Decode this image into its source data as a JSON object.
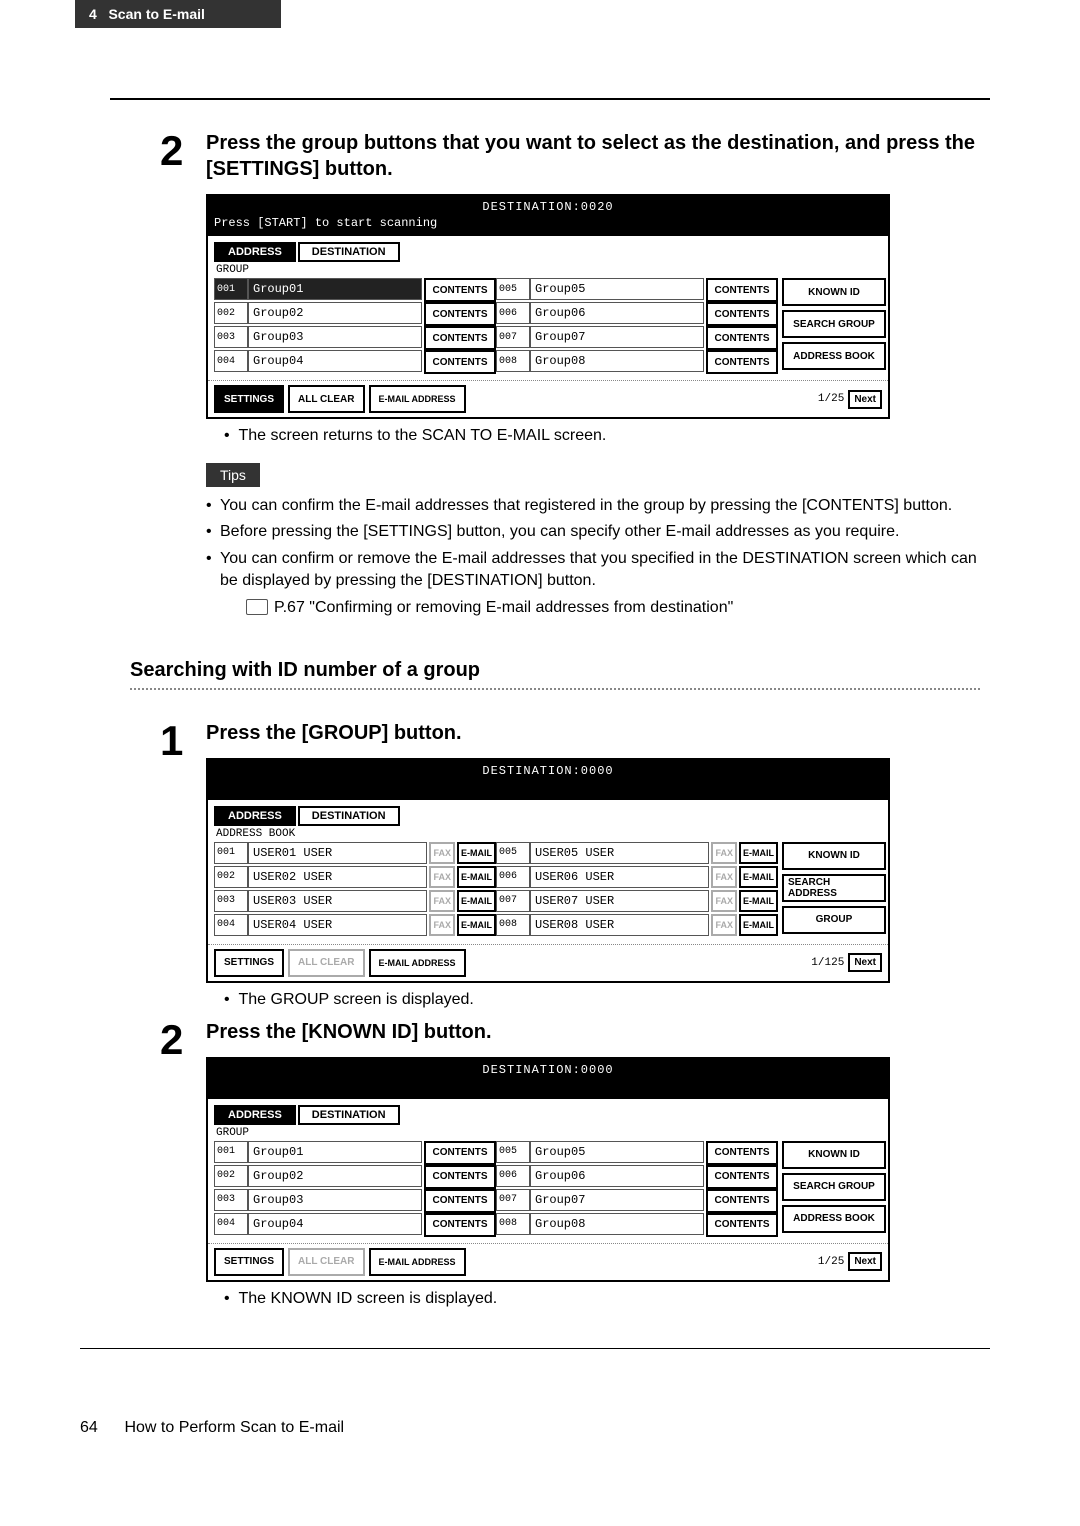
{
  "header": {
    "chapter": "4",
    "title": "Scan to E-mail"
  },
  "step2a": {
    "num": "2",
    "title": "Press the group buttons that you want to select as the destination, and press the [SETTINGS] button.",
    "note": "The screen returns to the SCAN TO E-MAIL screen."
  },
  "panel1": {
    "dest": "DESTINATION:0020",
    "prompt": "Press [START] to start scanning",
    "tabs": {
      "address": "ADDRESS",
      "destination": "DESTINATION"
    },
    "label": "GROUP",
    "left": [
      {
        "id": "001",
        "name": "Group01",
        "sel": true
      },
      {
        "id": "002",
        "name": "Group02"
      },
      {
        "id": "003",
        "name": "Group03"
      },
      {
        "id": "004",
        "name": "Group04"
      }
    ],
    "right": [
      {
        "id": "005",
        "name": "Group05"
      },
      {
        "id": "006",
        "name": "Group06"
      },
      {
        "id": "007",
        "name": "Group07"
      },
      {
        "id": "008",
        "name": "Group08"
      }
    ],
    "contents": "CONTENTS",
    "side": [
      "KNOWN ID",
      "SEARCH GROUP",
      "ADDRESS BOOK"
    ],
    "bottom": {
      "settings": "SETTINGS",
      "allclear": "ALL CLEAR",
      "emailaddr": "E-MAIL ADDRESS",
      "page": "1/25",
      "next": "Next"
    }
  },
  "tips": {
    "label": "Tips",
    "items": [
      "You can confirm the E-mail addresses that registered in the group by pressing the [CONTENTS] button.",
      "Before pressing the [SETTINGS] button, you can specify other E-mail addresses as you require.",
      "You can confirm or remove the E-mail addresses that you specified in the DESTINATION screen which can be displayed by pressing the [DESTINATION] button."
    ],
    "ref": "P.67 \"Confirming or removing E-mail addresses from destination\""
  },
  "section": "Searching with ID number of a group",
  "step1": {
    "num": "1",
    "title": "Press the [GROUP] button.",
    "note": "The GROUP screen is displayed."
  },
  "panel2": {
    "dest": "DESTINATION:0000",
    "tabs": {
      "address": "ADDRESS",
      "destination": "DESTINATION"
    },
    "label": "ADDRESS BOOK",
    "left": [
      {
        "id": "001",
        "name": "USER01 USER"
      },
      {
        "id": "002",
        "name": "USER02 USER"
      },
      {
        "id": "003",
        "name": "USER03 USER"
      },
      {
        "id": "004",
        "name": "USER04 USER"
      }
    ],
    "right": [
      {
        "id": "005",
        "name": "USER05 USER"
      },
      {
        "id": "006",
        "name": "USER06 USER"
      },
      {
        "id": "007",
        "name": "USER07 USER"
      },
      {
        "id": "008",
        "name": "USER08 USER"
      }
    ],
    "fax": "FAX",
    "email": "E-MAIL",
    "side": [
      "KNOWN ID",
      "SEARCH ADDRESS",
      "GROUP"
    ],
    "bottom": {
      "settings": "SETTINGS",
      "allclear": "ALL CLEAR",
      "emailaddr": "E-MAIL ADDRESS",
      "page": "1/125",
      "next": "Next"
    }
  },
  "step2b": {
    "num": "2",
    "title": "Press the [KNOWN ID] button.",
    "note": "The KNOWN ID screen is displayed."
  },
  "panel3": {
    "dest": "DESTINATION:0000",
    "tabs": {
      "address": "ADDRESS",
      "destination": "DESTINATION"
    },
    "label": "GROUP",
    "left": [
      {
        "id": "001",
        "name": "Group01"
      },
      {
        "id": "002",
        "name": "Group02"
      },
      {
        "id": "003",
        "name": "Group03"
      },
      {
        "id": "004",
        "name": "Group04"
      }
    ],
    "right": [
      {
        "id": "005",
        "name": "Group05"
      },
      {
        "id": "006",
        "name": "Group06"
      },
      {
        "id": "007",
        "name": "Group07"
      },
      {
        "id": "008",
        "name": "Group08"
      }
    ],
    "contents": "CONTENTS",
    "side": [
      "KNOWN ID",
      "SEARCH GROUP",
      "ADDRESS BOOK"
    ],
    "bottom": {
      "settings": "SETTINGS",
      "allclear": "ALL CLEAR",
      "emailaddr": "E-MAIL ADDRESS",
      "page": "1/25",
      "next": "Next"
    }
  },
  "footer": {
    "page": "64",
    "text": "How to Perform Scan to E-mail"
  }
}
